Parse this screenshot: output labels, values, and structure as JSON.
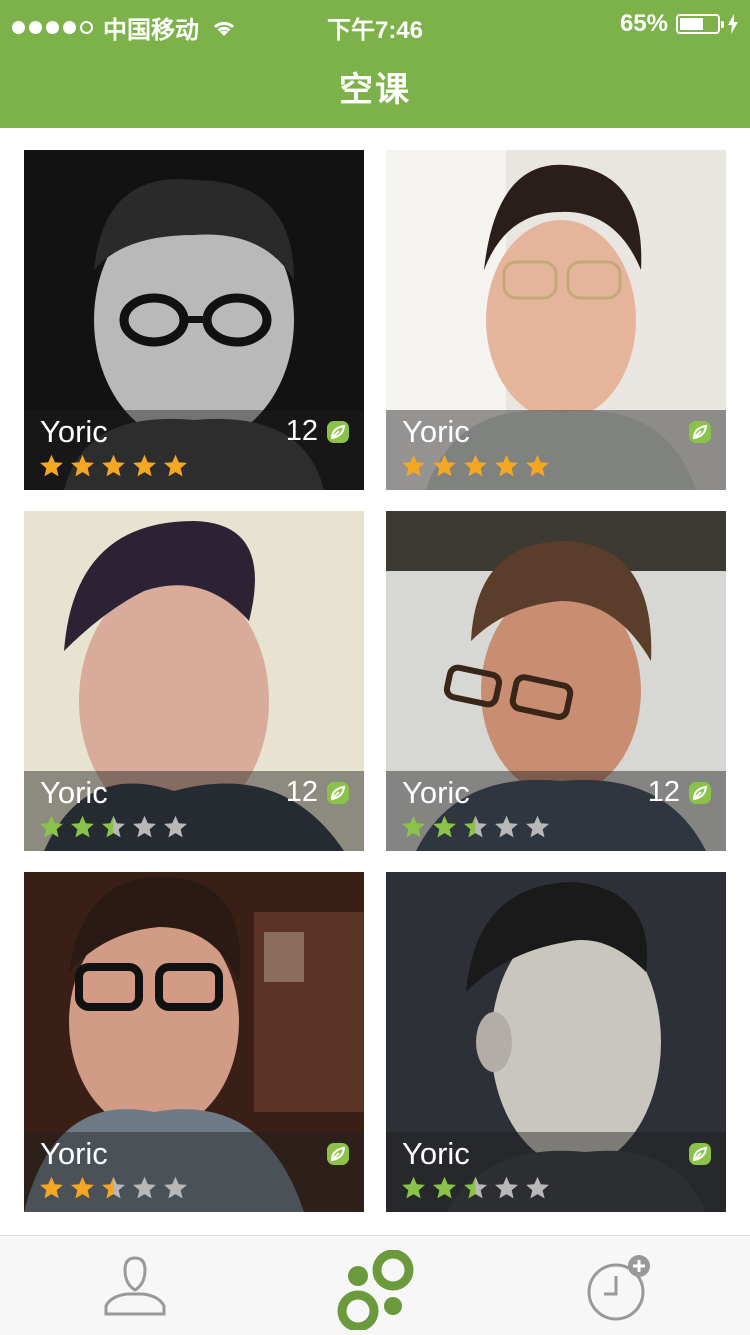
{
  "status_bar": {
    "carrier": "中国移动",
    "time": "下午7:46",
    "battery_text": "65%",
    "battery_level": 0.65,
    "signal_bars": 4
  },
  "header": {
    "title": "空课"
  },
  "colors": {
    "brand_green": "#7db24b",
    "star_orange": "#f5a623",
    "star_green": "#8bc34a",
    "star_gray": "#b8b8b8",
    "leaf_green": "#8bc34a"
  },
  "cards": [
    {
      "name": "Yoric",
      "count": "12",
      "rating": 5,
      "star_color": "orange"
    },
    {
      "name": "Yoric",
      "count": "",
      "rating": 5,
      "star_color": "orange"
    },
    {
      "name": "Yoric",
      "count": "12",
      "rating": 2.5,
      "star_color": "green"
    },
    {
      "name": "Yoric",
      "count": "12",
      "rating": 2.5,
      "star_color": "green"
    },
    {
      "name": "Yoric",
      "count": "",
      "rating": 2.5,
      "star_color": "orange"
    },
    {
      "name": "Yoric",
      "count": "",
      "rating": 2.5,
      "star_color": "green"
    }
  ],
  "tabbar": {
    "items": [
      {
        "icon": "person-icon",
        "active": false
      },
      {
        "icon": "circles-icon",
        "active": true
      },
      {
        "icon": "clock-add-icon",
        "active": false
      }
    ]
  }
}
